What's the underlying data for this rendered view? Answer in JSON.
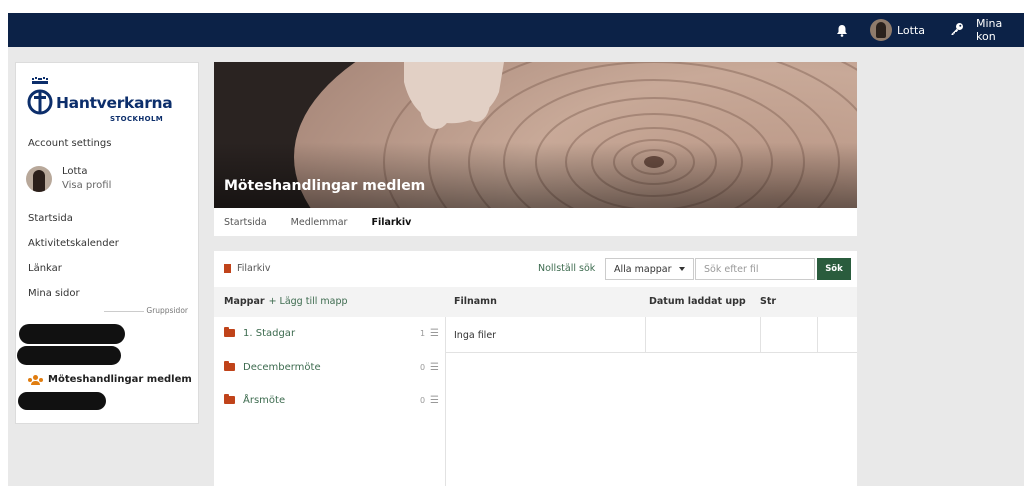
{
  "topbar": {
    "user_name": "Lotta",
    "account_label": "Mina kon",
    "bg_color": "#0c2247"
  },
  "sidebar": {
    "logo_text": "Hantverkarna",
    "logo_sub": "STOCKHOLM",
    "account_settings": "Account settings",
    "profile_name": "Lotta",
    "profile_link": "Visa profil",
    "nav": [
      "Startsida",
      "Aktivitetskalender",
      "Länkar",
      "Mina sidor"
    ],
    "group_label": "Gruppsidor",
    "active_group": "Möteshandlingar medlem"
  },
  "banner": {
    "title": "Möteshandlingar medlem"
  },
  "tabs": [
    "Startsida",
    "Medlemmar",
    "Filarkiv"
  ],
  "active_tab": "Filarkiv",
  "toolbar": {
    "crumb": "Filarkiv",
    "reset": "Nollställ sök",
    "select_value": "Alla mappar",
    "search_placeholder": "Sök efter fil",
    "search_button": "Sök",
    "accent_color": "#2a5c3d"
  },
  "columns": {
    "folders": "Mappar",
    "add_folder": "+ Lägg till mapp",
    "filename": "Filnamn",
    "date": "Datum laddat upp",
    "size": "Str"
  },
  "folders": [
    {
      "name": "1. Stadgar",
      "count": "1"
    },
    {
      "name": "Decembermöte",
      "count": "0"
    },
    {
      "name": "Årsmöte",
      "count": "0"
    }
  ],
  "empty_files": "Inga filer"
}
